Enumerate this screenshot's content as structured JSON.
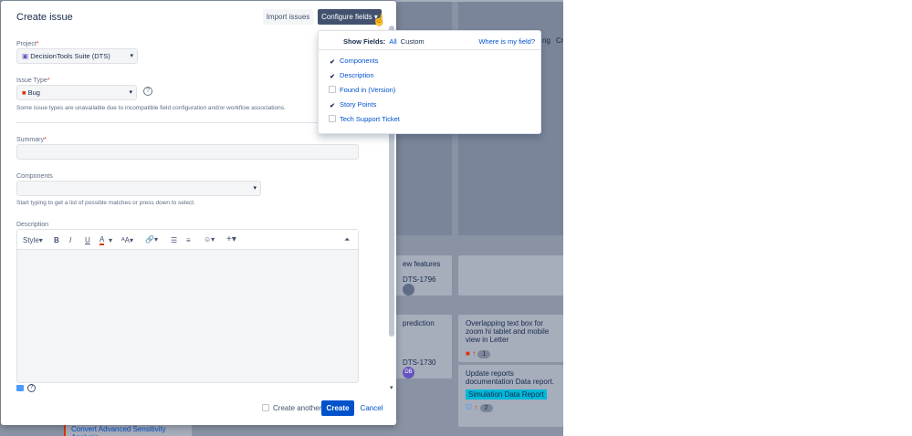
{
  "background": {
    "card_features": "ew features",
    "card_features_key": "DTS-1796",
    "card_prediction": "prediction",
    "card_prediction_key": "DTS-1730",
    "card_prediction_avatar": "DB",
    "card_overlap": "Overlapping text box for zoom hi tablet and mobile view in Letter",
    "card_overlap_count": "1",
    "card_update": "Update reports documentation Data report.",
    "card_update_label": "Simulation Data Report",
    "card_update_count": "2",
    "bottom_card": "Convert Advanced Sensitivity Analysis",
    "top_right_text1": "ng",
    "top_right_text2": "Cr"
  },
  "modal": {
    "title": "Create issue",
    "import_label": "Import issues",
    "configure_label": "Configure fields",
    "project_label": "Project",
    "project_value": "DecisionTools Suite (DTS)",
    "issue_type_label": "Issue Type",
    "issue_type_value": "Bug",
    "issue_type_hint": "Some issue types are unavailable due to incompatible field configuration and/or workflow associations.",
    "summary_label": "Summary",
    "components_label": "Components",
    "components_hint": "Start typing to get a list of possible matches or press down to select.",
    "description_label": "Description",
    "style_label": "Style",
    "create_another_label": "Create another",
    "create_label": "Create",
    "cancel_label": "Cancel"
  },
  "dropdown": {
    "show_fields_label": "Show Fields:",
    "all_label": "All",
    "custom_label": "Custom",
    "where_label": "Where is my field?",
    "fields": [
      {
        "label": "Components",
        "checked": true
      },
      {
        "label": "Description",
        "checked": true
      },
      {
        "label": "Found in (Version)",
        "checked": false
      },
      {
        "label": "Story Points",
        "checked": true
      },
      {
        "label": "Tech Support Ticket",
        "checked": false
      }
    ]
  },
  "colors": {
    "primary": "#0052cc",
    "configure_bg": "#42526e",
    "backdrop": "#8993a4",
    "bug": "#de350b"
  }
}
